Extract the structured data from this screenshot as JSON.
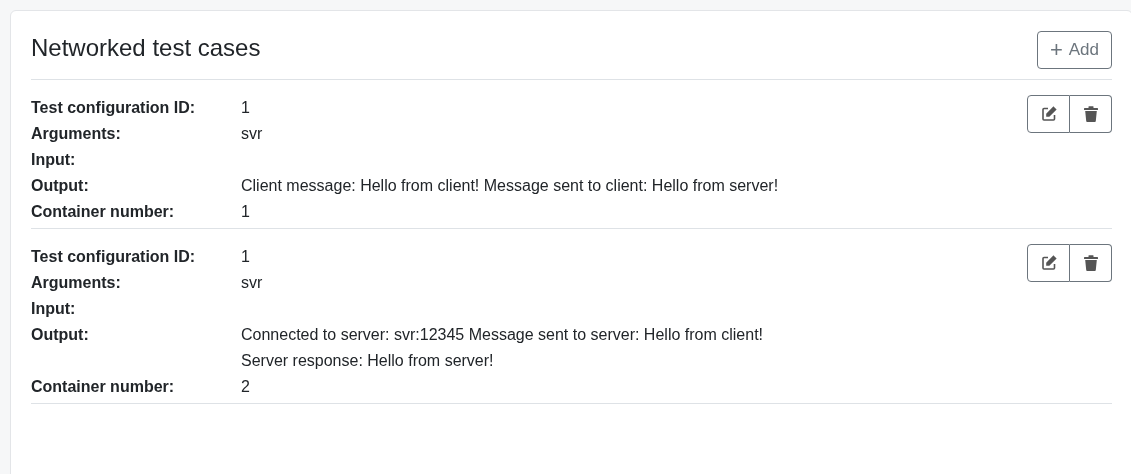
{
  "title": "Networked test cases",
  "add_button": {
    "icon": "+",
    "label": "Add"
  },
  "test_cases": [
    {
      "fields": [
        {
          "label": "Test configuration ID:",
          "lines": [
            "1"
          ]
        },
        {
          "label": "Arguments:",
          "lines": [
            "svr"
          ]
        },
        {
          "label": "Input:"
        },
        {
          "label": "Output:",
          "lines": [
            "Client message: Hello from client! Message sent to client: Hello from server!"
          ]
        },
        {
          "label": "Container number:",
          "lines": [
            "1"
          ]
        }
      ]
    },
    {
      "fields": [
        {
          "label": "Test configuration ID:",
          "lines": [
            "1"
          ]
        },
        {
          "label": "Arguments:",
          "lines": [
            "svr"
          ]
        },
        {
          "label": "Input:"
        },
        {
          "label": "Output:",
          "lines": [
            "Connected to server: svr:12345 Message sent to server: Hello from client!",
            "Server response: Hello from server!"
          ]
        },
        {
          "label": "Container number:",
          "lines": [
            "2"
          ]
        }
      ]
    }
  ]
}
